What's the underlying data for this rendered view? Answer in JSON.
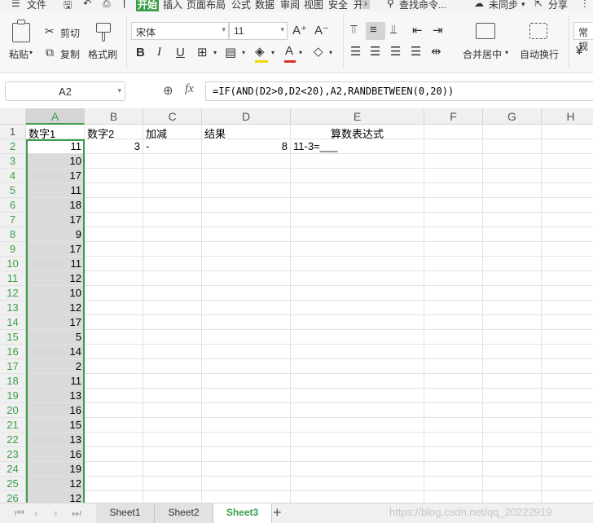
{
  "menu": {
    "items": [
      "文件",
      "开始",
      "插入",
      "页面布局",
      "公式",
      "数据",
      "审阅",
      "视图",
      "安全",
      "开"
    ],
    "search": "查找命令...",
    "sync": "未同步",
    "share": "分享"
  },
  "ribbon": {
    "paste": "粘贴",
    "cut": "剪切",
    "copy": "复制",
    "format_painter": "格式刷",
    "font_name": "宋体",
    "font_size": "11",
    "bold": "B",
    "italic": "I",
    "underline": "U",
    "font_color_glyph": "A",
    "merge_center": "合并居中",
    "wrap_text": "自动换行",
    "number_format": "常规",
    "font_color": "#d93025",
    "fill_color": "#f2d600"
  },
  "formula_bar": {
    "name_box": "A2",
    "fx": "fx",
    "formula": "=IF(AND(D2>0,D2<20),A2,RANDBETWEEN(0,20))"
  },
  "grid": {
    "columns": [
      "A",
      "B",
      "C",
      "D",
      "E",
      "F",
      "G",
      "H"
    ],
    "selected_column": "A",
    "row_numbers": [
      "1",
      "2",
      "3",
      "4",
      "5",
      "6",
      "7",
      "8",
      "9",
      "10",
      "11",
      "12",
      "13",
      "14",
      "15",
      "16",
      "17",
      "18",
      "19",
      "20",
      "21",
      "22",
      "23",
      "24",
      "25",
      "26"
    ],
    "headers": {
      "a": "数字1",
      "b": "数字2",
      "c": "加减",
      "d": "结果",
      "e": "算数表达式"
    },
    "row2": {
      "b": "3",
      "c": "-",
      "d": "8",
      "e": "11-3=___"
    },
    "column_a": [
      "11",
      "10",
      "17",
      "11",
      "18",
      "17",
      "9",
      "17",
      "11",
      "12",
      "10",
      "12",
      "17",
      "5",
      "14",
      "2",
      "11",
      "13",
      "16",
      "15",
      "13",
      "16",
      "19",
      "12",
      "12"
    ]
  },
  "sheet_tabs": {
    "tabs": [
      "Sheet1",
      "Sheet2",
      "Sheet3"
    ],
    "active": "Sheet3",
    "add": "+"
  },
  "watermark": "https://blog.csdn.net/qq_20222919"
}
